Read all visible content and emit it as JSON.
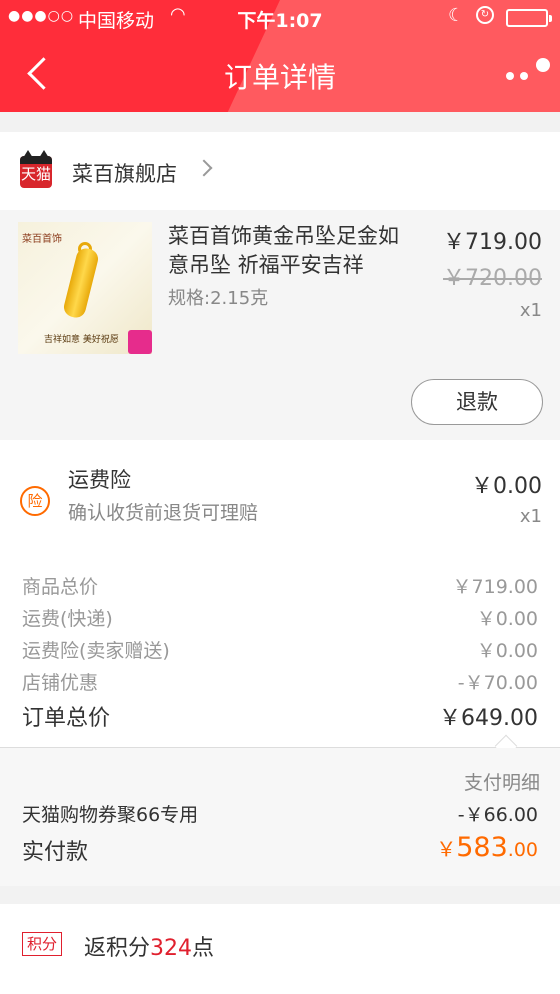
{
  "status_bar": {
    "carrier": "中国移动",
    "time": "下午1:07",
    "signal": "●●●○○"
  },
  "nav": {
    "title": "订单详情"
  },
  "shop": {
    "logo_text": "天猫",
    "name": "菜百旗舰店"
  },
  "product": {
    "image_brand": "菜百首饰",
    "image_slogan": "吉祥如意 美好祝愿",
    "title": "菜百首饰黄金吊坠足金如意吊坠 祈福平安吉祥",
    "spec": "规格:2.15克",
    "price": "￥719.00",
    "original_price": "￥720.00",
    "quantity": "x1",
    "refund_label": "退款"
  },
  "insurance": {
    "icon_text": "险",
    "title": "运费险",
    "description": "确认收货前退货可理赔",
    "price": "￥0.00",
    "quantity": "x1"
  },
  "summary": {
    "rows": [
      {
        "label": "商品总价",
        "value": "￥719.00"
      },
      {
        "label": "运费(快递)",
        "value": "￥0.00"
      },
      {
        "label": "运费险(卖家赠送)",
        "value": "￥0.00"
      },
      {
        "label": "店铺优惠",
        "value": "-￥70.00"
      }
    ],
    "total_label": "订单总价",
    "total_value": "￥649.00"
  },
  "payment": {
    "detail_link": "支付明细",
    "coupon_label": "天猫购物券聚66专用",
    "coupon_value": "-￥66.00",
    "actual_label": "实付款",
    "actual_currency": "￥",
    "actual_integer": "583",
    "actual_decimal": ".00"
  },
  "points": {
    "tag": "积分",
    "prefix": "返积分",
    "amount": "324",
    "suffix": "点"
  },
  "colors": {
    "header_red": "#ff2d3a",
    "accent_orange": "#ff6a00",
    "points_red": "#e0202e"
  }
}
